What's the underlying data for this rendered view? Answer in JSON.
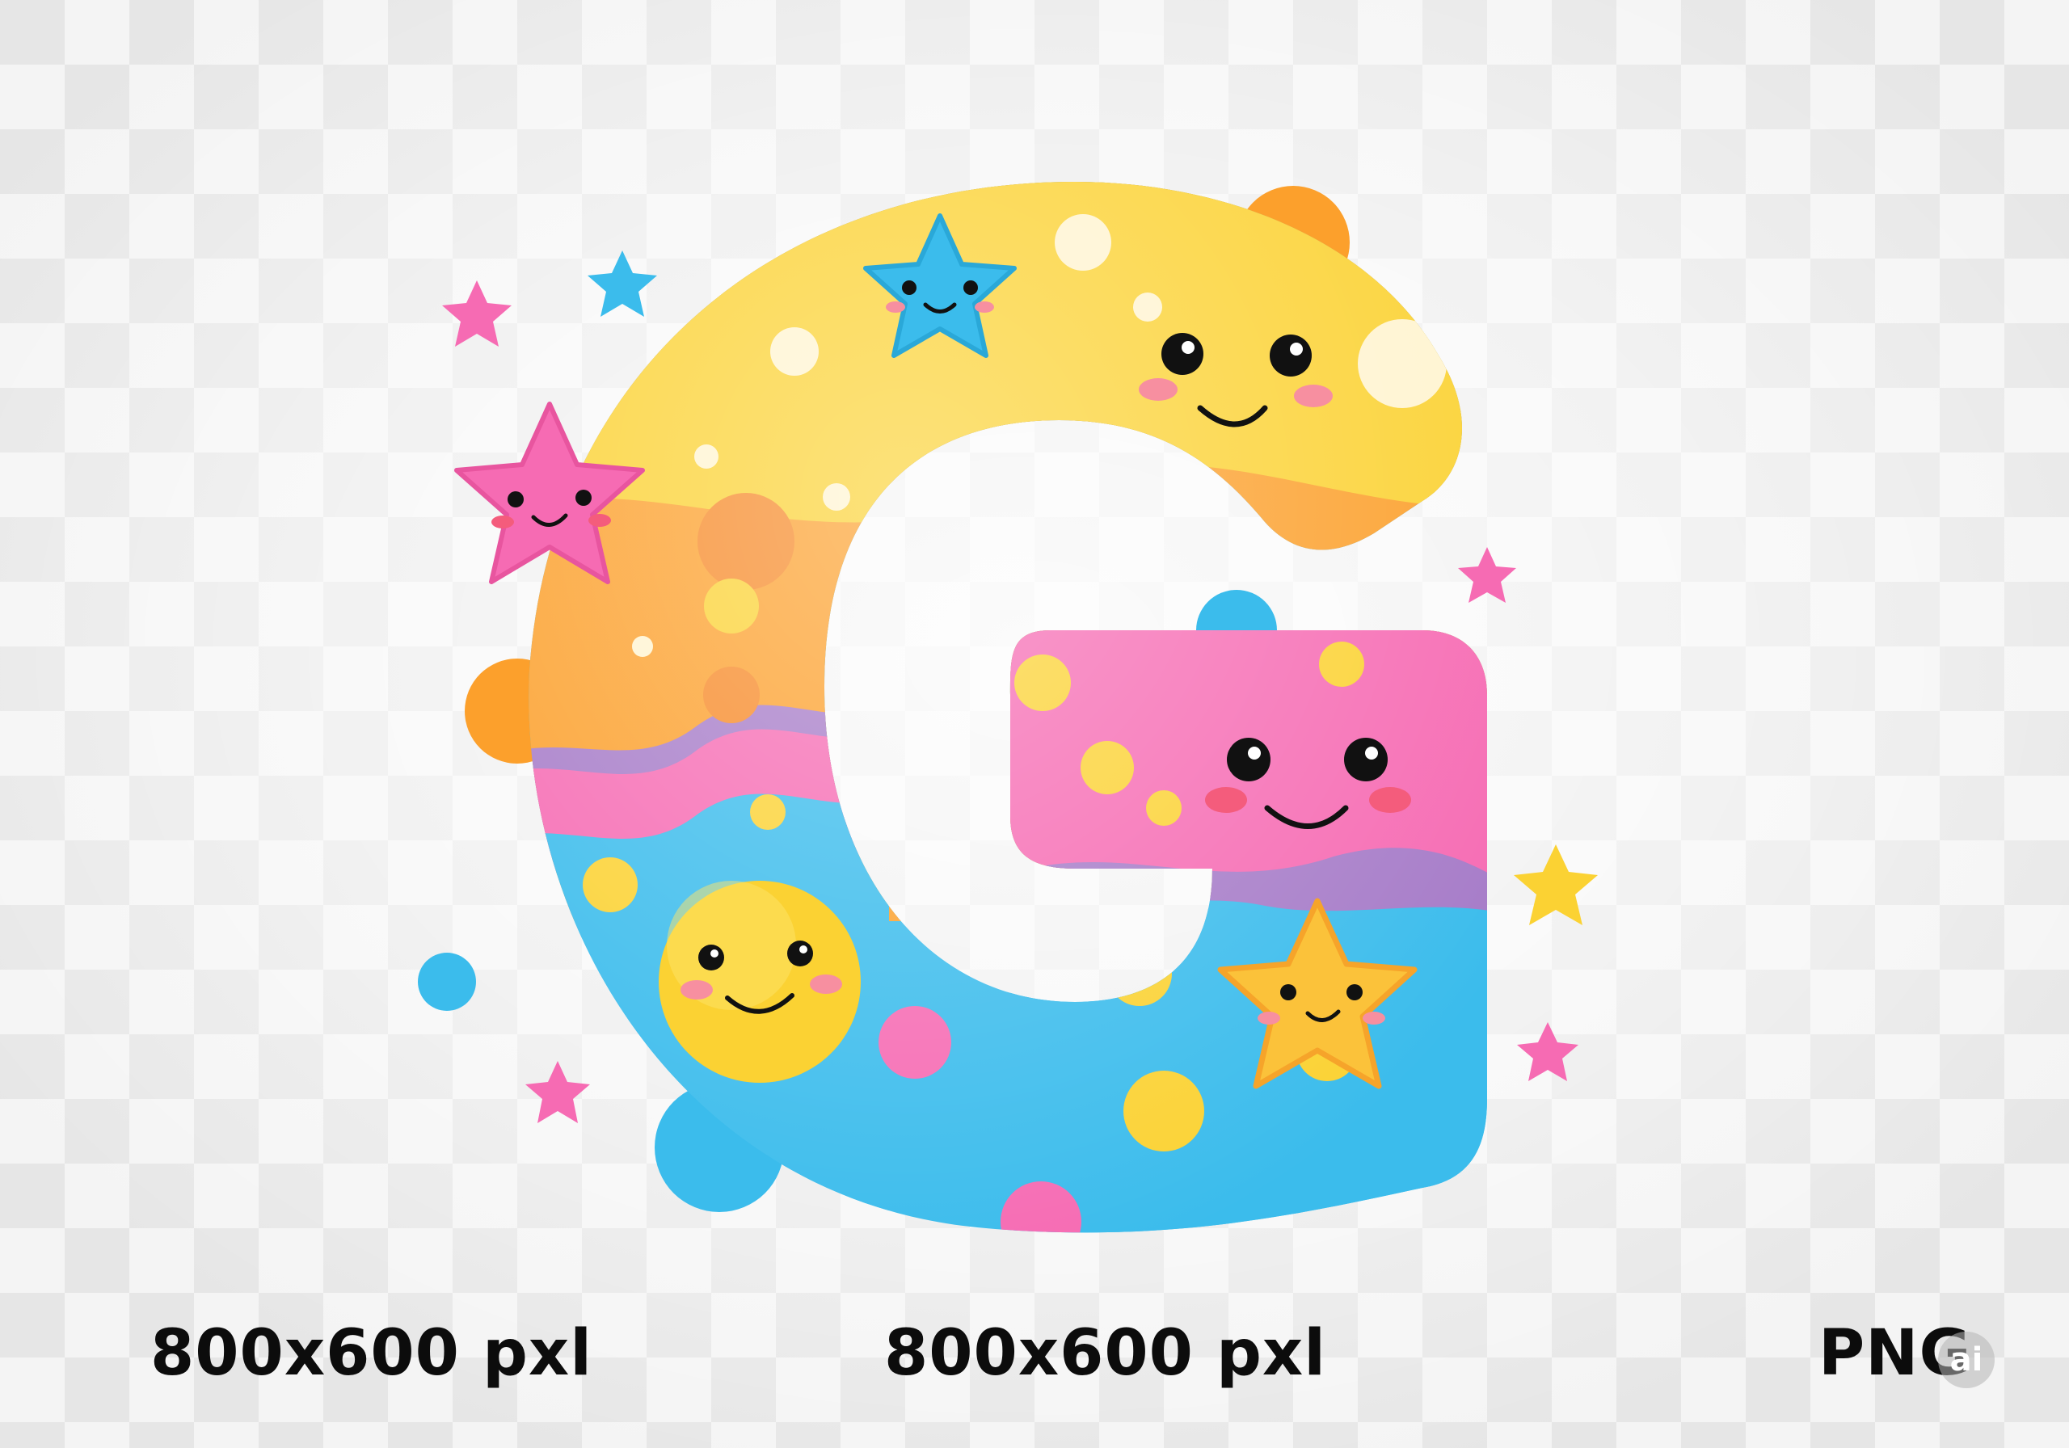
{
  "image": {
    "subject": "letter-g-illustration",
    "background": "transparency-checkerboard",
    "colors": {
      "yellow": "#fbd233",
      "orange": "#fca02c",
      "pink": "#f66bb3",
      "blue": "#3bbcec",
      "purple": "#a67bc8",
      "checker_light": "#f4f4f4",
      "checker_dark": "#e2e2e2",
      "caption": "#0c0c0c"
    }
  },
  "captions": {
    "left": "800x600 pxl",
    "middle": "800x600 pxl",
    "right": "PNG"
  },
  "watermark": {
    "text": "ai"
  }
}
